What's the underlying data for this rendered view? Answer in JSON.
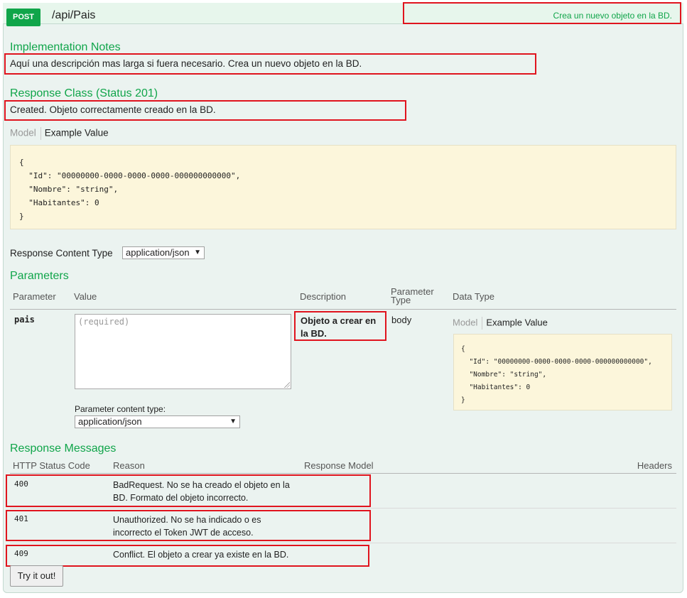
{
  "endpoint": {
    "method": "POST",
    "path": "/api/Pais",
    "summary": "Crea un nuevo objeto en la BD."
  },
  "implementation": {
    "title": "Implementation Notes",
    "notes": "Aquí una descripción mas larga si fuera necesario. Crea un nuevo objeto en la BD."
  },
  "response_class": {
    "title": "Response Class (Status 201)",
    "description": "Created. Objeto correctamente creado en la BD.",
    "tab_model": "Model",
    "tab_example": "Example Value",
    "example": "{\n  \"Id\": \"00000000-0000-0000-0000-000000000000\",\n  \"Nombre\": \"string\",\n  \"Habitantes\": 0\n}"
  },
  "content_type": {
    "label": "Response Content Type",
    "value": "application/json"
  },
  "parameters": {
    "title": "Parameters",
    "headers": {
      "parameter": "Parameter",
      "value": "Value",
      "description": "Description",
      "type_line1": "Parameter",
      "type_line2": "Type",
      "data_type": "Data Type"
    },
    "row": {
      "name": "pais",
      "placeholder": "(required)",
      "description_line1": "Objeto a crear en",
      "description_line2": "la BD.",
      "type": "body",
      "tab_model": "Model",
      "tab_example": "Example Value",
      "example": "{\n  \"Id\": \"00000000-0000-0000-0000-000000000000\",\n  \"Nombre\": \"string\",\n  \"Habitantes\": 0\n}",
      "content_type_label": "Parameter content type:",
      "content_type_value": "application/json"
    }
  },
  "responses": {
    "title": "Response Messages",
    "headers": {
      "code": "HTTP Status Code",
      "reason": "Reason",
      "model": "Response Model",
      "headers": "Headers"
    },
    "rows": [
      {
        "code": "400",
        "reason_line1": "BadRequest. No se ha creado el objeto en la",
        "reason_line2": "BD. Formato del objeto incorrecto."
      },
      {
        "code": "401",
        "reason_line1": "Unauthorized. No se ha indicado o es",
        "reason_line2": "incorrecto el Token JWT de acceso."
      },
      {
        "code": "409",
        "reason_line1": "Conflict. El objeto a crear ya existe en la BD.",
        "reason_line2": ""
      }
    ]
  },
  "try_button": "Try it out!",
  "colors": {
    "accent": "#10a54a",
    "highlight_box": "#e0141e",
    "code_bg": "#fcf6db"
  }
}
